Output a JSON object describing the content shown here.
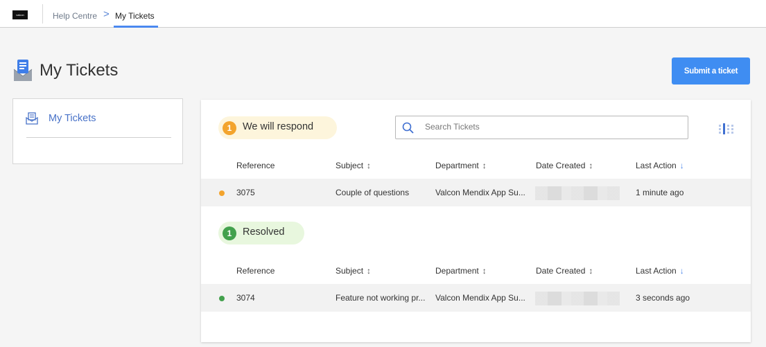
{
  "topbar": {
    "logo_text": "valcon",
    "breadcrumb_home": "Help Centre",
    "breadcrumb_separator": ">",
    "breadcrumb_current": "My Tickets"
  },
  "page": {
    "title": "My Tickets",
    "submit_label": "Submit a ticket"
  },
  "sidebar": {
    "items": [
      {
        "label": "My Tickets",
        "icon": "tickets-envelope-icon"
      }
    ]
  },
  "search": {
    "placeholder": "Search Tickets",
    "value": ""
  },
  "columns": [
    "Reference",
    "Subject",
    "Department",
    "Date Created",
    "Last Action"
  ],
  "groups": [
    {
      "label": "We will respond",
      "count": "1",
      "color": "#f3a42d",
      "tickets": [
        {
          "reference": "3075",
          "subject": "Couple of questions",
          "department": "Valcon Mendix App Su...",
          "date_created": "",
          "last_action": "1 minute ago"
        }
      ]
    },
    {
      "label": "Resolved",
      "count": "1",
      "color": "#43a14d",
      "tickets": [
        {
          "reference": "3074",
          "subject": "Feature not working pr...",
          "department": "Valcon Mendix App Su...",
          "date_created": "",
          "last_action": "3 seconds ago"
        }
      ]
    }
  ],
  "colors": {
    "accent": "#3f8df2",
    "link": "#4872c8"
  }
}
